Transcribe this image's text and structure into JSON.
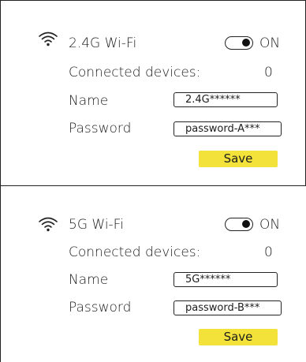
{
  "networks": [
    {
      "title": "2.4G Wi-Fi",
      "icon": "wifi-icon",
      "toggle_label": "ON",
      "toggle_on": true,
      "connected_label": "Connected devices:",
      "connected_count": "0",
      "name_label": "Name",
      "name_value": "2.4G******",
      "password_label": "Password",
      "password_value": "password-A***",
      "save_label": "Save"
    },
    {
      "title": "5G Wi-Fi",
      "icon": "wifi-icon",
      "toggle_label": "ON",
      "toggle_on": true,
      "connected_label": "Connected devices:",
      "connected_count": "0",
      "name_label": "Name",
      "name_value": "5G******",
      "password_label": "Password",
      "password_value": "password-B***",
      "save_label": "Save"
    }
  ],
  "colors": {
    "save_button": "#f2e23a",
    "border": "#222222",
    "text": "#1c1c1c"
  }
}
